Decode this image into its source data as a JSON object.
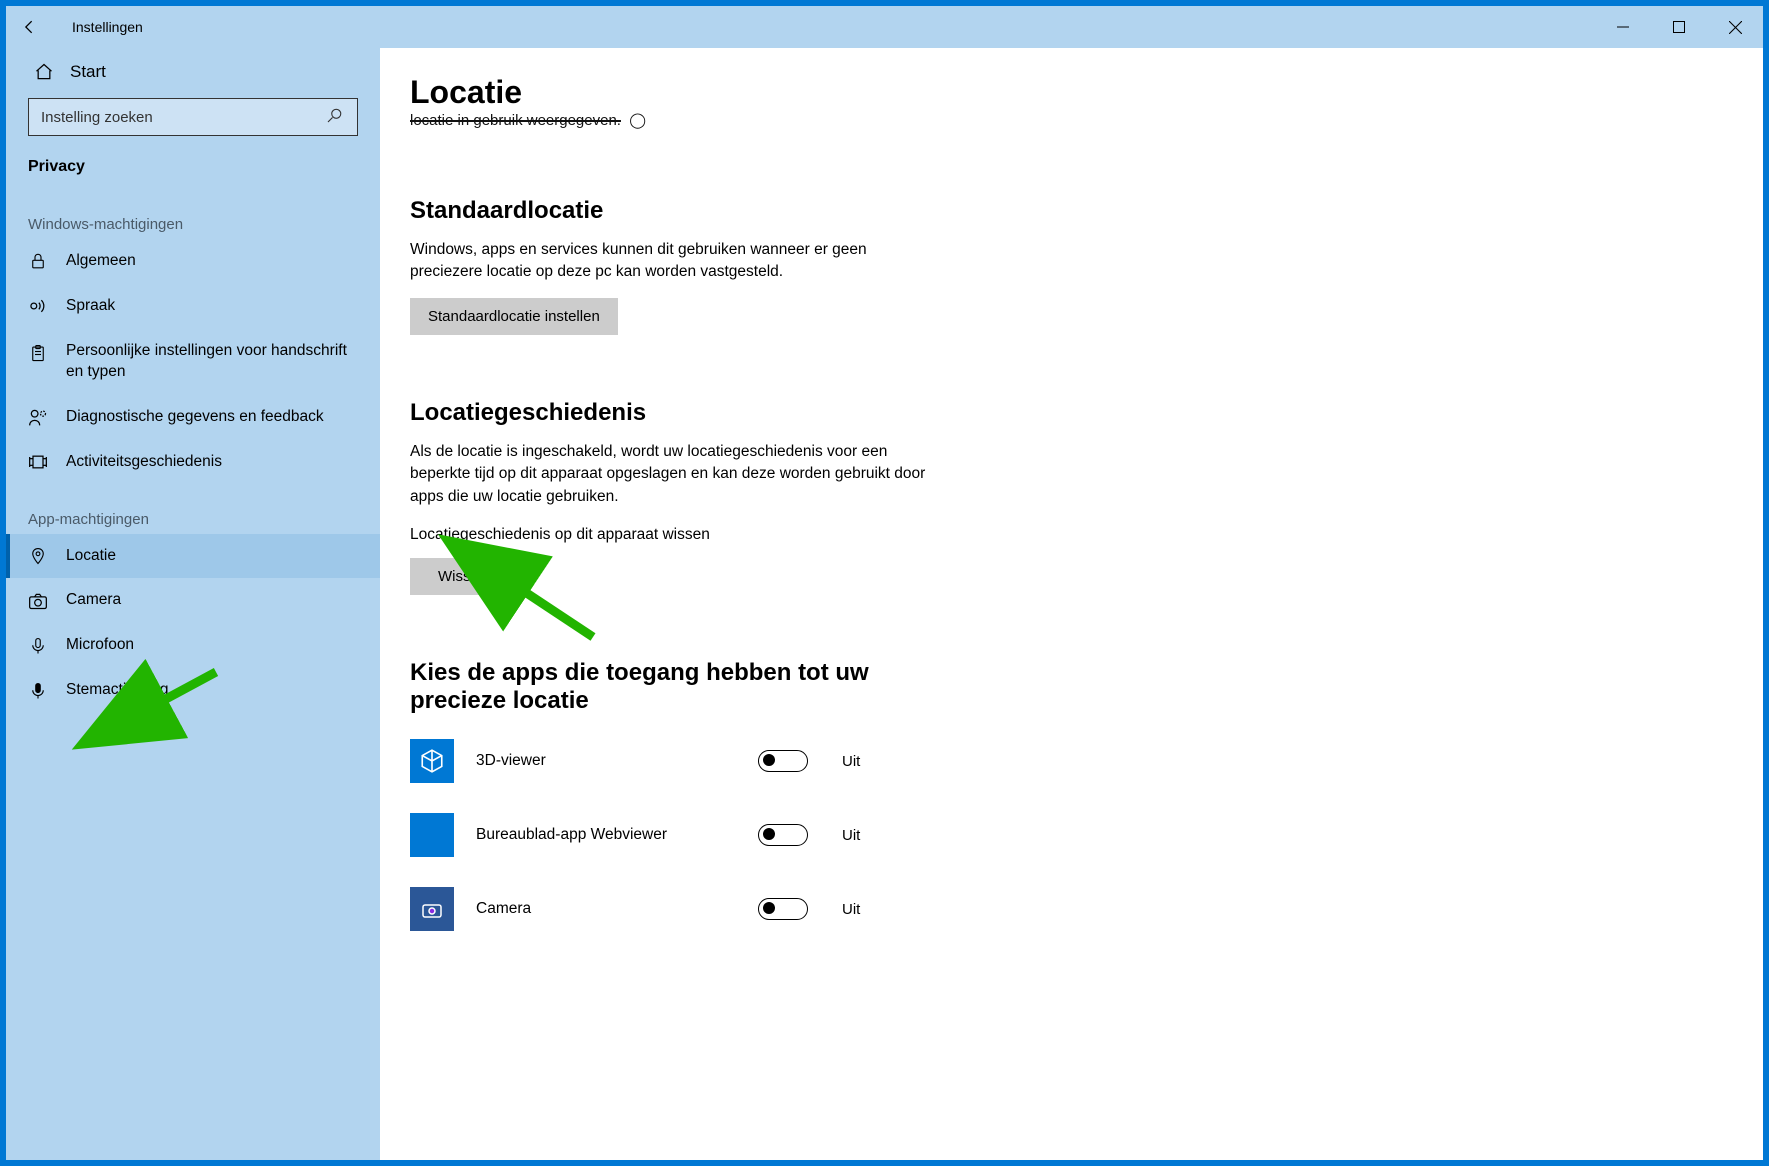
{
  "window": {
    "title": "Instellingen"
  },
  "sidebar": {
    "home": "Start",
    "search_placeholder": "Instelling zoeken",
    "section_main": "Privacy",
    "section_windows": "Windows-machtigingen",
    "section_apps": "App-machtigingen",
    "win_items": [
      {
        "id": "algemeen",
        "label": "Algemeen"
      },
      {
        "id": "spraak",
        "label": "Spraak"
      },
      {
        "id": "handschrift",
        "label": "Persoonlijke instellingen voor handschrift en typen"
      },
      {
        "id": "diagnostiek",
        "label": "Diagnostische gegevens en feedback"
      },
      {
        "id": "activiteit",
        "label": "Activiteitsgeschiedenis"
      }
    ],
    "app_items": [
      {
        "id": "locatie",
        "label": "Locatie",
        "selected": true
      },
      {
        "id": "camera",
        "label": "Camera"
      },
      {
        "id": "microfoon",
        "label": "Microfoon"
      },
      {
        "id": "stemactivering",
        "label": "Stemactivering"
      }
    ]
  },
  "main": {
    "heading": "Locatie",
    "truncated_line": "locatie in gebruik weergegeven.",
    "section_default": {
      "title": "Standaardlocatie",
      "desc": "Windows, apps en services kunnen dit gebruiken wanneer er geen preciezere locatie op deze pc kan worden vastgesteld.",
      "button": "Standaardlocatie instellen"
    },
    "section_history": {
      "title": "Locatiegeschiedenis",
      "desc": "Als de locatie is ingeschakeld, wordt uw locatiegeschiedenis voor een beperkte tijd op dit apparaat opgeslagen en kan deze worden gebruikt door apps die uw locatie gebruiken.",
      "sub": "Locatiegeschiedenis op dit apparaat wissen",
      "button": "Wissen"
    },
    "section_apps": {
      "title": "Kies de apps die toegang hebben tot uw precieze locatie",
      "apps": [
        {
          "name": "3D-viewer",
          "state": "Uit"
        },
        {
          "name": "Bureaublad-app Webviewer",
          "state": "Uit"
        },
        {
          "name": "Camera",
          "state": "Uit"
        }
      ]
    }
  }
}
